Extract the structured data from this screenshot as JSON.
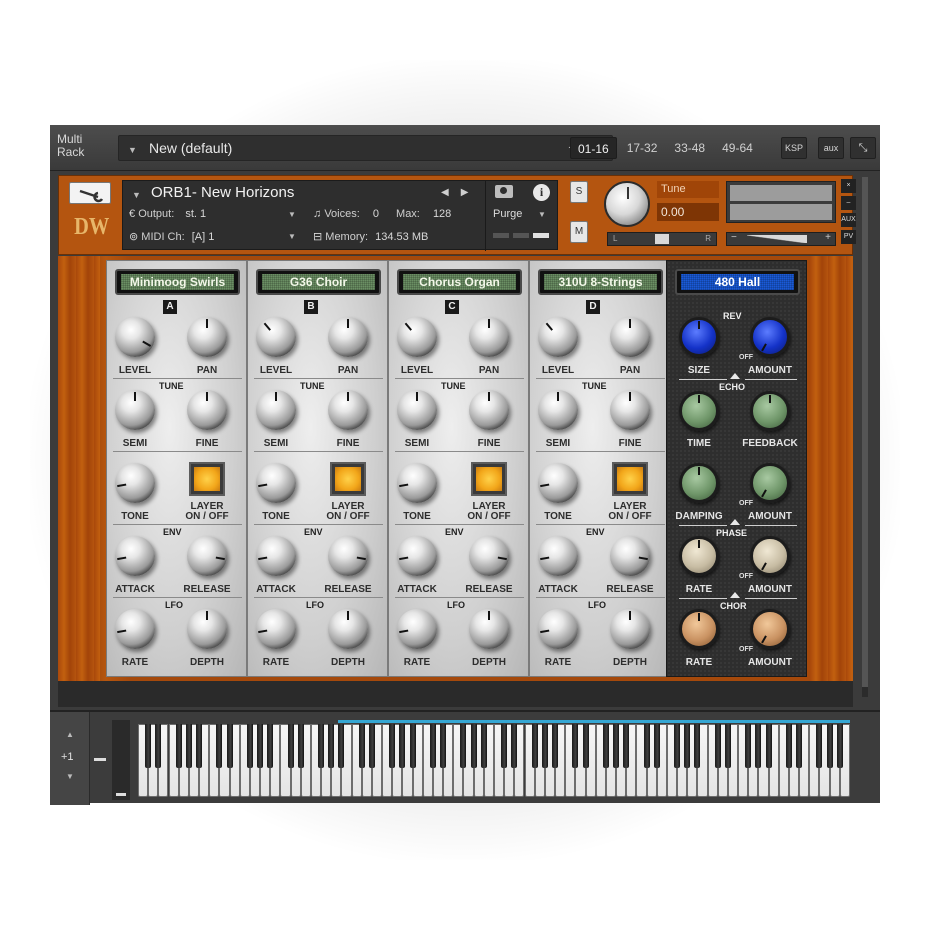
{
  "rack": {
    "title": "Multi Rack",
    "preset_name": "New (default)",
    "page_tabs": [
      "01-16",
      "17-32",
      "33-48",
      "49-64"
    ],
    "active_tab": "01-16",
    "ksp_label": "KSP",
    "aux_label": "aux"
  },
  "instrument": {
    "logo": "DW",
    "name": "ORB1- New Horizons",
    "output_label": "Output:",
    "output_value": "st. 1",
    "voices_label": "Voices:",
    "voices_value": "0",
    "max_label": "Max:",
    "max_value": "128",
    "midi_label": "MIDI Ch:",
    "midi_value": "[A]  1",
    "memory_label": "Memory:",
    "memory_value": "134.53 MB",
    "purge_label": "Purge",
    "solo_label": "S",
    "mute_label": "M",
    "tune_label": "Tune",
    "tune_value": "0.00",
    "pan_left": "L",
    "pan_right": "R",
    "side_buttons": [
      "×",
      "–",
      "AUX",
      "PV"
    ]
  },
  "channels": [
    {
      "letter": "A",
      "display": "Minimoog Swirls"
    },
    {
      "letter": "B",
      "display": "G36 Choir"
    },
    {
      "letter": "C",
      "display": "Chorus Organ"
    },
    {
      "letter": "D",
      "display": "310U 8-Strings"
    }
  ],
  "channel_labels": {
    "level": "LEVEL",
    "pan": "PAN",
    "tune": "TUNE",
    "semi": "SEMI",
    "fine": "FINE",
    "tone": "TONE",
    "layer": "LAYER",
    "onoff": "ON / OFF",
    "env": "ENV",
    "attack": "ATTACK",
    "release": "RELEASE",
    "lfo": "LFO",
    "rate": "RATE",
    "depth": "DEPTH"
  },
  "fx": {
    "display": "480 Hall",
    "rev": "REV",
    "size": "SIZE",
    "amount": "AMOUNT",
    "off": "OFF",
    "echo": "ECHO",
    "time": "TIME",
    "feedback": "FEEDBACK",
    "damping": "DAMPING",
    "phase": "PHASE",
    "rate": "RATE",
    "chor": "CHOR"
  },
  "keyboard": {
    "octave_value": "+1",
    "up_arrow": "▲",
    "down_arrow": "▼"
  },
  "colors": {
    "accent_orange": "#b45510",
    "lcd_green": "#6b8f64",
    "lcd_blue": "#1a5ad8",
    "range_blue": "#35a7d4"
  }
}
